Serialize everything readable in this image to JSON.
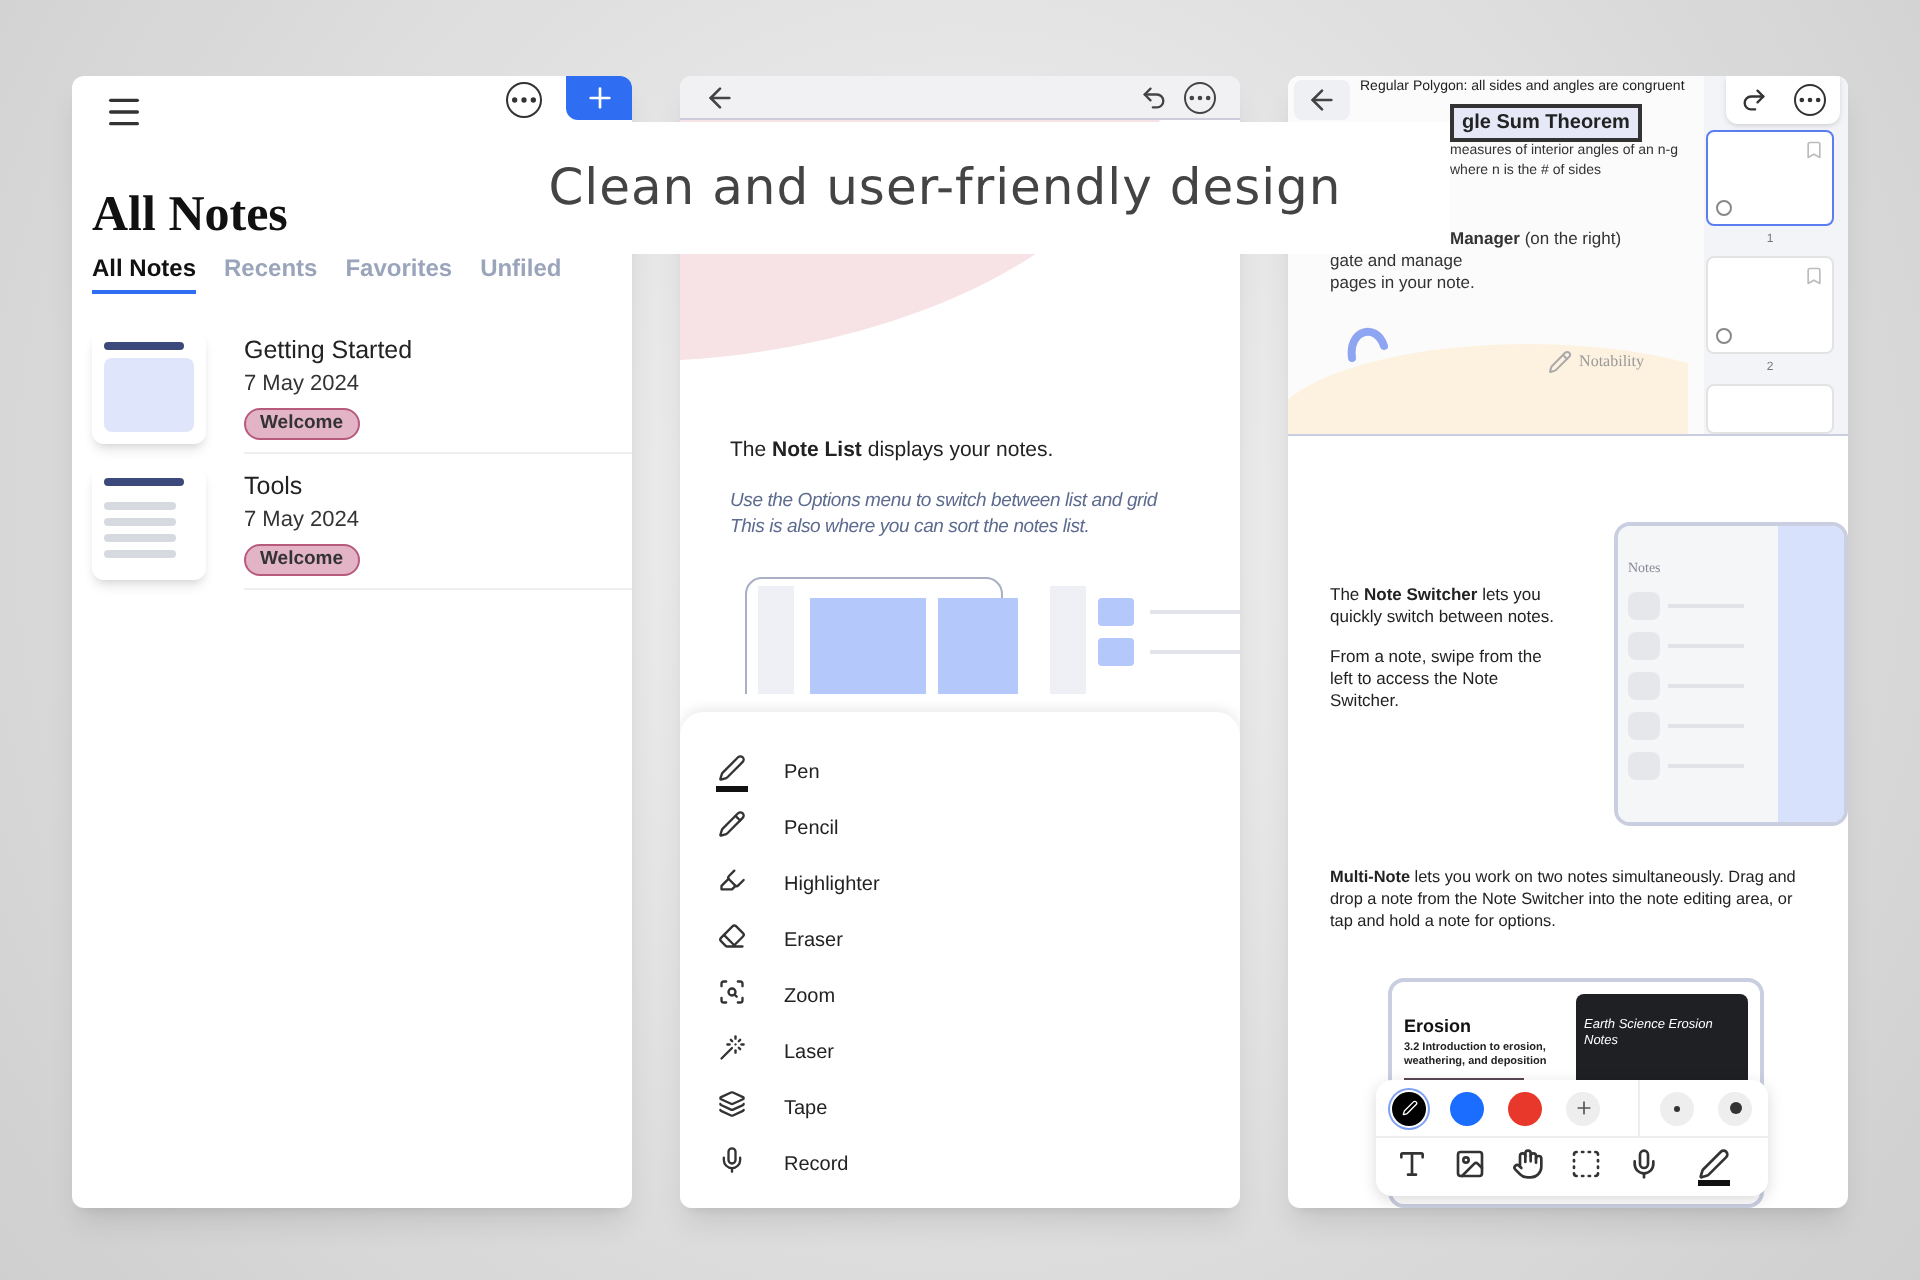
{
  "caption": "Clean and user-friendly design",
  "notes_screen": {
    "title": "All Notes",
    "tabs": [
      {
        "label": "All Notes",
        "selected": true
      },
      {
        "label": "Recents",
        "selected": false
      },
      {
        "label": "Favorites",
        "selected": false
      },
      {
        "label": "Unfiled",
        "selected": false
      }
    ],
    "notes": [
      {
        "title": "Getting Started",
        "date": "7 May 2024",
        "tag": "Welcome"
      },
      {
        "title": "Tools",
        "date": "7 May 2024",
        "tag": "Welcome"
      }
    ]
  },
  "tools_screen": {
    "intro": "The **Note List** displays your notes.",
    "hint_lines": [
      "Use the Options menu to switch between list and grid",
      "This is also where you can sort the notes list."
    ],
    "tools": [
      {
        "kind": "pen",
        "label": "Pen",
        "selected": true
      },
      {
        "kind": "pencil",
        "label": "Pencil",
        "selected": false
      },
      {
        "kind": "highlighter",
        "label": "Highlighter",
        "selected": false
      },
      {
        "kind": "eraser",
        "label": "Eraser",
        "selected": false
      },
      {
        "kind": "zoom",
        "label": "Zoom",
        "selected": false
      },
      {
        "kind": "laser",
        "label": "Laser",
        "selected": false
      },
      {
        "kind": "tape",
        "label": "Tape",
        "selected": false
      },
      {
        "kind": "record",
        "label": "Record",
        "selected": false
      }
    ]
  },
  "editor_screen": {
    "note_lines": [
      "Regular Polygon: all sides and angles are congruent"
    ],
    "theorem": "gle Sum Theorem",
    "formula_lines": [
      "measures of interior angles of an n-g",
      "where n is the # of sides"
    ],
    "manager_lines": [
      "**Manager** (on the right)",
      "gate and manage",
      "pages in your note."
    ],
    "brand": "Notability",
    "pages": [
      {
        "number": "1",
        "selected": true
      },
      {
        "number": "2",
        "selected": false
      }
    ],
    "switcher_text": "The **Note Switcher** lets you quickly switch between notes.",
    "switcher_hint": "From a note, swipe from the left to access the Note Switcher.",
    "mock_title": "Notes",
    "multi_note": "**Multi-Note** lets you work on two notes simultaneously. Drag and drop a note from the Note Switcher into the note editing area, or tap and hold a note for options.",
    "erosion_title": "Erosion",
    "erosion_subtitle": "3.2 Introduction to erosion, weathering, and deposition",
    "erosion_notes_title": "Earth Science Erosion Notes",
    "colors": [
      {
        "color": "#000000",
        "selected": true
      },
      {
        "color": "#1a6dff",
        "selected": false
      },
      {
        "color": "#e8382b",
        "selected": false
      }
    ],
    "toolbar": [
      {
        "kind": "text",
        "selected": false
      },
      {
        "kind": "image",
        "selected": false
      },
      {
        "kind": "hand",
        "selected": false
      },
      {
        "kind": "select",
        "selected": false
      },
      {
        "kind": "mic",
        "selected": false
      },
      {
        "kind": "pen",
        "selected": true
      }
    ]
  }
}
